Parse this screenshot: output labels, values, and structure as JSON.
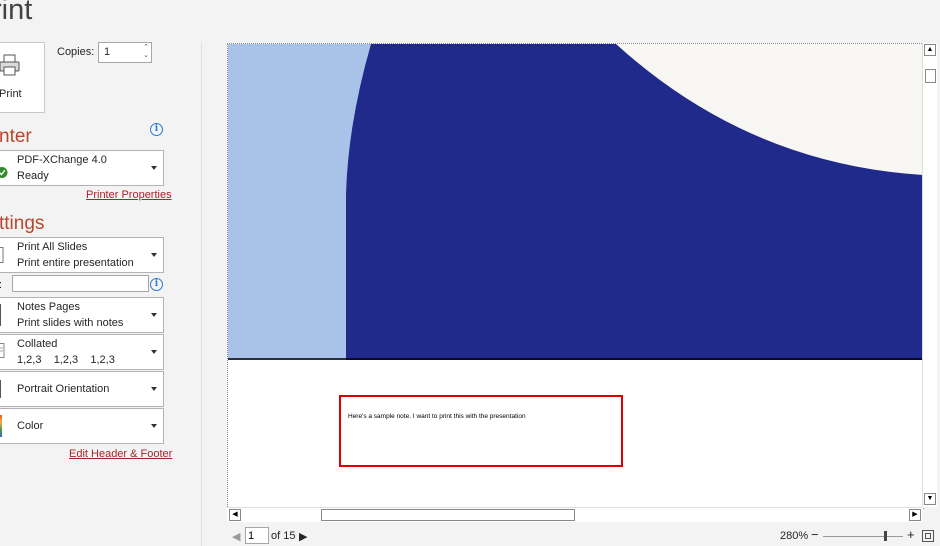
{
  "panel": {
    "title": "rint"
  },
  "print": {
    "button_label": "Print"
  },
  "copies": {
    "label": "Copies:",
    "value": "1"
  },
  "printer": {
    "heading": "nter",
    "name": "PDF-XChange 4.0",
    "status": "Ready",
    "properties_link": "Printer Properties"
  },
  "settings": {
    "heading": "ttings",
    "slides_label": ":",
    "slides_value": "",
    "dropdowns": [
      {
        "line1": "Print All Slides",
        "line2": "Print entire presentation"
      },
      {
        "line1": "Notes Pages",
        "line2": "Print slides with notes"
      },
      {
        "line1": "Collated",
        "line2": "1,2,3    1,2,3    1,2,3"
      },
      {
        "line1": "Portrait Orientation",
        "line2": ""
      },
      {
        "line1": "Color",
        "line2": ""
      }
    ],
    "edit_header_footer_link": "Edit Header & Footer"
  },
  "preview": {
    "note_text": "Here's a sample note. I want to print this with the presentation"
  },
  "pager": {
    "current_page": "1",
    "of_label": "of 15"
  },
  "zoom": {
    "level": "280%",
    "minus": "−",
    "plus": "+"
  },
  "colors": {
    "accent": "#b7472a",
    "slide_navy": "#1f2a8b",
    "slide_light_blue": "#a9c3e8",
    "slide_cream": "#f8f6f2",
    "note_border": "#e00000"
  },
  "icons": [
    "printer-icon",
    "printer-ready-icon",
    "info-icon",
    "page-icon",
    "fit-to-window-icon"
  ]
}
